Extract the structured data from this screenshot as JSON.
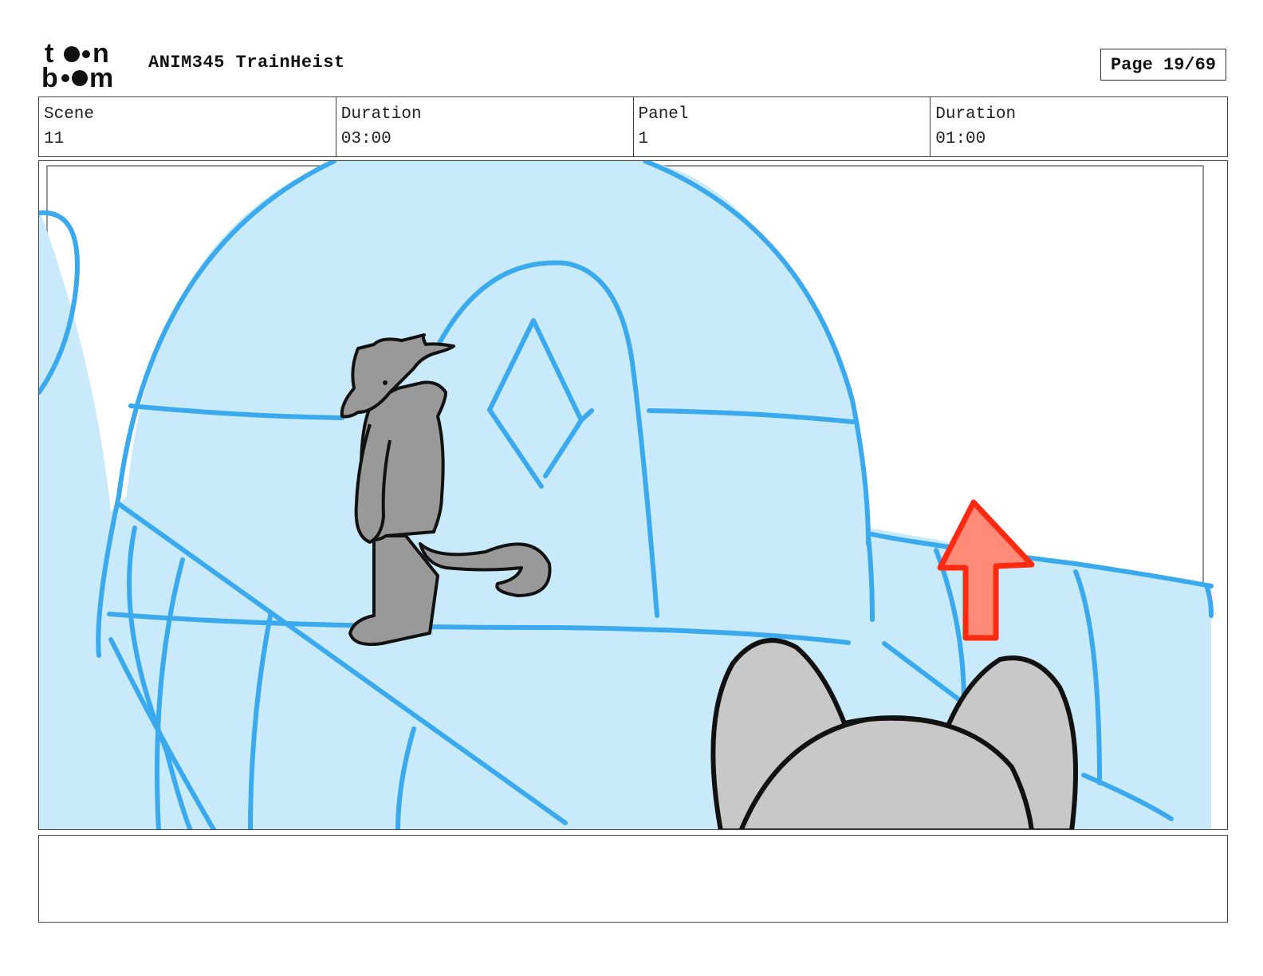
{
  "header": {
    "logo_text_top": "toon",
    "logo_text_bottom": "boom",
    "project_title": "ANIM345 TrainHeist",
    "page_indicator": "Page 19/69"
  },
  "info": [
    {
      "label": "Scene",
      "value": "11"
    },
    {
      "label": "Duration",
      "value": "03:00"
    },
    {
      "label": "Panel",
      "value": "1"
    },
    {
      "label": "Duration",
      "value": "01:00"
    }
  ],
  "panel": {
    "colors": {
      "sky": "#ffffff",
      "ice_fill": "#c8eafb",
      "ice_line": "#3aa9ee",
      "character_fill": "#999999",
      "foreground_head_fill": "#c8c8c8",
      "outline": "#111111",
      "arrow_fill": "#ff8a78",
      "arrow_line": "#ff2a10"
    },
    "icons": [
      "arrow-up-icon"
    ]
  },
  "notes": {
    "text": ""
  }
}
